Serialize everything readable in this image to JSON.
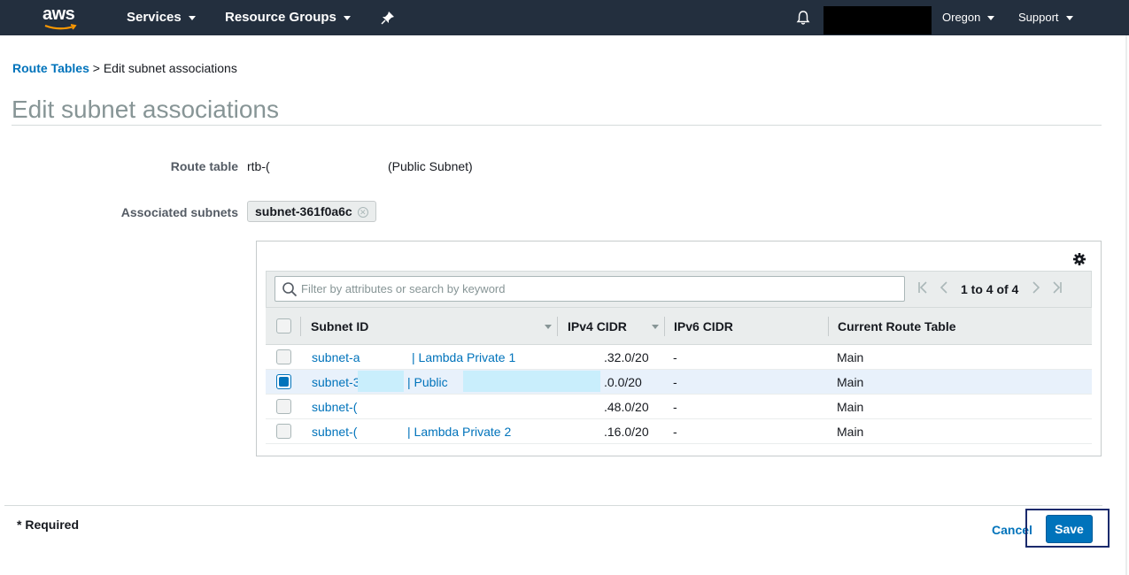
{
  "nav": {
    "logo": "aws",
    "services": "Services",
    "resource_groups": "Resource Groups",
    "region": "Oregon",
    "support": "Support"
  },
  "breadcrumb": {
    "parent": "Route Tables",
    "separator": ">",
    "current": "Edit subnet associations"
  },
  "page": {
    "title": "Edit subnet associations"
  },
  "form": {
    "route_table_label": "Route table",
    "route_table_id": "rtb-(",
    "route_table_name": "(Public Subnet)",
    "associated_label": "Associated subnets",
    "associated_token": "subnet-361f0a6c"
  },
  "table": {
    "search_placeholder": "Filter by attributes or search by keyword",
    "pagination": "1 to 4 of 4",
    "columns": [
      "Subnet ID",
      "IPv4 CIDR",
      "IPv6 CIDR",
      "Current Route Table"
    ],
    "rows": [
      {
        "checked": false,
        "subnet_prefix": "subnet-a",
        "subnet_name": "| Lambda Private 1",
        "ipv4": ".32.0/20",
        "ipv6": "-",
        "route_table": "Main"
      },
      {
        "checked": true,
        "subnet_prefix": "subnet-3",
        "subnet_name": "| Public",
        "ipv4": ".0.0/20",
        "ipv6": "-",
        "route_table": "Main"
      },
      {
        "checked": false,
        "subnet_prefix": "subnet-(",
        "subnet_name": "",
        "ipv4": ".48.0/20",
        "ipv6": "-",
        "route_table": "Main"
      },
      {
        "checked": false,
        "subnet_prefix": "subnet-(",
        "subnet_name": "| Lambda Private 2",
        "ipv4": ".16.0/20",
        "ipv6": "-",
        "route_table": "Main"
      }
    ]
  },
  "footer": {
    "required": "* Required",
    "cancel": "Cancel",
    "save": "Save"
  },
  "colors": {
    "nav_bg": "#232f3e",
    "link": "#0073bb",
    "primary": "#0073bb",
    "selected_row": "#e8f1fb"
  }
}
